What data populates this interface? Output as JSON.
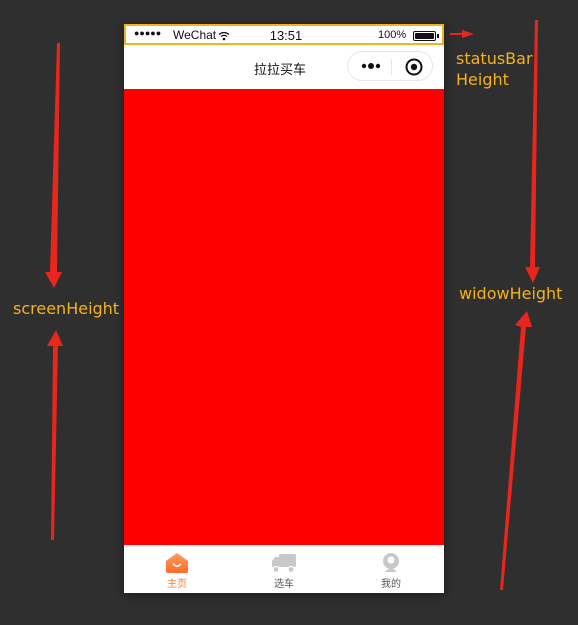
{
  "status_bar": {
    "signal": "●●●●●",
    "carrier": "WeChat",
    "time": "13:51",
    "battery": "100%",
    "wifi_icon": "wifi-icon",
    "battery_icon": "battery-icon"
  },
  "nav_bar": {
    "title": "拉拉买车",
    "more_icon": "more-dots-icon",
    "close_icon": "target-circle-icon"
  },
  "content": {
    "background": "#ff0000"
  },
  "tab_bar": {
    "items": [
      {
        "label": "主页",
        "icon": "home-icon",
        "active": true,
        "color": "#ff7a2e"
      },
      {
        "label": "选车",
        "icon": "truck-icon",
        "active": false,
        "color": "#555555"
      },
      {
        "label": "我的",
        "icon": "user-icon",
        "active": false,
        "color": "#555555"
      }
    ]
  },
  "annotations": {
    "status_bar_height": "statusBar Height",
    "screen_height": "screenHeight",
    "window_height": "widowHeight",
    "color": "#f5b21c",
    "arrow_color": "#e8261d"
  }
}
